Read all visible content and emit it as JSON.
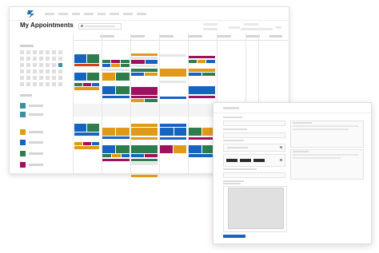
{
  "app": {
    "title": "My Appointments",
    "logo_icon": "logo-icon"
  },
  "colors": {
    "blue": "#1565c0",
    "green": "#2e7d4f",
    "purple": "#a0105e",
    "orange": "#e09a17",
    "teal": "#3a8fa0",
    "red": "#d84315",
    "light": "#e6e6e6",
    "save": "#1565c0"
  },
  "legend": [
    {
      "color": "#3a8fa0"
    },
    {
      "color": "#3a8fa0"
    },
    {
      "color": "#e09a17"
    },
    {
      "color": "#1565c0"
    },
    {
      "color": "#2e7d4f"
    },
    {
      "color": "#a0105e"
    }
  ],
  "popup": {
    "save_icon": "save-button"
  }
}
